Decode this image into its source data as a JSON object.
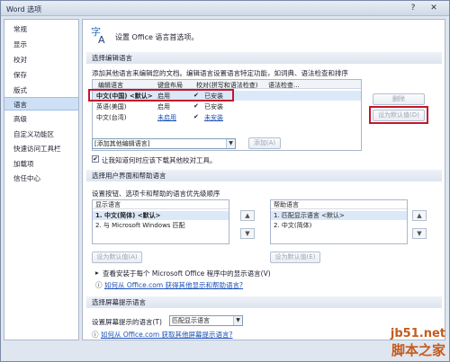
{
  "window": {
    "title": "Word 选项",
    "help": "?",
    "close": "✕"
  },
  "sidebar": {
    "items": [
      {
        "label": "常规"
      },
      {
        "label": "显示"
      },
      {
        "label": "校对"
      },
      {
        "label": "保存"
      },
      {
        "label": "版式"
      },
      {
        "label": "语言"
      },
      {
        "label": "高级"
      },
      {
        "label": "自定义功能区"
      },
      {
        "label": "快速访问工具栏"
      },
      {
        "label": "加载项"
      },
      {
        "label": "信任中心"
      }
    ],
    "active": "语言"
  },
  "header": {
    "text": "设置 Office 语言首选项。"
  },
  "edit_lang": {
    "section": "选择编辑语言",
    "desc": "添加其他语言来编辑您的文档。编辑语言设置语言特定功能，如词典、语法检查和排序",
    "columns": [
      "编辑语言",
      "键盘布局",
      "校对(拼写和语法检查)",
      "语法检查..."
    ],
    "rows": [
      {
        "lang": "中文(中国) <默认>",
        "kb": "启用",
        "proof": "已安装"
      },
      {
        "lang": "英语(美国)",
        "kb": "启用",
        "proof": "已安装"
      },
      {
        "lang": "中文(台湾)",
        "kb": "未启用",
        "proof": "未安装"
      }
    ],
    "remove_btn": "删除",
    "default_btn": "设为默认值(D)",
    "add_combo": "[添加其他编辑语言]",
    "add_btn": "添加(A)",
    "checkbox_label": "让我知道何时应该下载其他校对工具。",
    "checkbox_checked": true
  },
  "ui_lang": {
    "section": "选择用户界面和帮助语言",
    "desc": "设置按钮、选项卡和帮助的语言优先级顺序",
    "display_title": "显示语言",
    "display_items": [
      "1.    中文(简体) <默认>",
      "2.    与 Microsoft Windows 匹配"
    ],
    "help_title": "帮助语言",
    "help_items": [
      "1.    匹配显示语言 <默认>",
      "2.    中文(简体)"
    ],
    "set_default": "设为默认值(A)",
    "set_default2": "设为默认值(E)",
    "view_label": "查看安装于每个 Microsoft Office 程序中的显示语言(V)",
    "link1": "如何从 Office.com 获得其他显示和帮助语言?"
  },
  "tooltip_lang": {
    "section": "选择屏幕提示语言",
    "label": "设置屏幕提示的语言(T)",
    "combo": "匹配显示语言",
    "link": "如何从 Office.com 获取其他屏幕提示语言?"
  },
  "watermark": {
    "line1": "jb51.net",
    "line2": "脚本之家"
  }
}
